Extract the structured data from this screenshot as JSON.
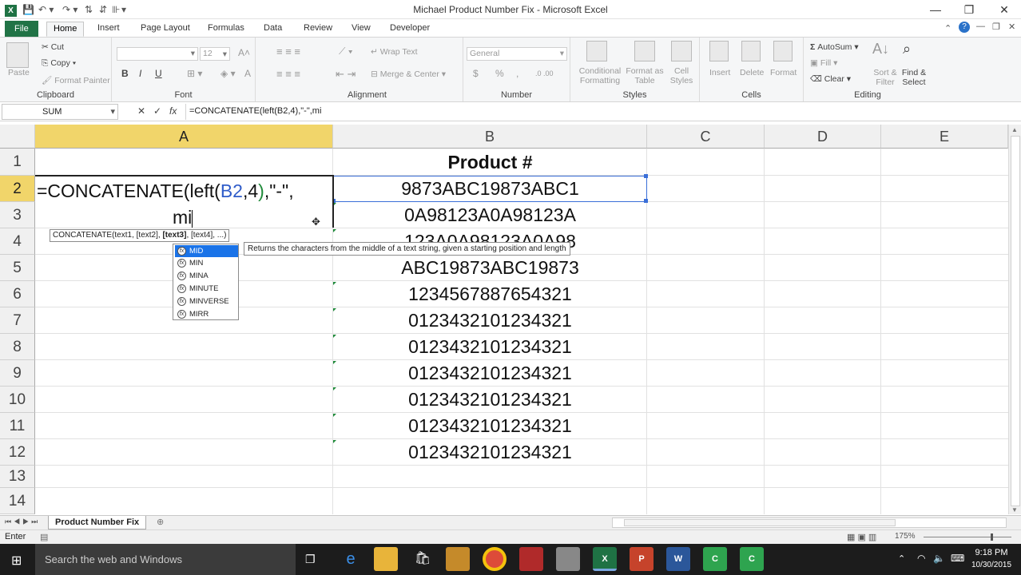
{
  "window": {
    "title": "Michael Product Number Fix - Microsoft Excel"
  },
  "tabs": [
    {
      "label": "File"
    },
    {
      "label": "Home"
    },
    {
      "label": "Insert"
    },
    {
      "label": "Page Layout"
    },
    {
      "label": "Formulas"
    },
    {
      "label": "Data"
    },
    {
      "label": "Review"
    },
    {
      "label": "View"
    },
    {
      "label": "Developer"
    }
  ],
  "ribbon": {
    "clipboard": {
      "name": "Clipboard",
      "paste": "Paste",
      "cut": "Cut",
      "copy": "Copy",
      "format_painter": "Format Painter"
    },
    "font": {
      "name": "Font",
      "size": "12",
      "bold": "B",
      "italic": "I",
      "underline": "U"
    },
    "alignment": {
      "name": "Alignment",
      "wrap": "Wrap Text",
      "merge": "Merge & Center"
    },
    "number": {
      "name": "Number",
      "format": "General",
      "currency": "$",
      "percent": "%",
      "comma": ","
    },
    "styles": {
      "name": "Styles",
      "conditional": "Conditional Formatting",
      "format_table": "Format as Table",
      "cell_styles": "Cell Styles"
    },
    "cells": {
      "name": "Cells",
      "insert": "Insert",
      "delete": "Delete",
      "format": "Format"
    },
    "editing": {
      "name": "Editing",
      "autosum": "AutoSum",
      "fill": "Fill",
      "clear": "Clear",
      "sort": "Sort & Filter",
      "find": "Find & Select"
    }
  },
  "formula_bar": {
    "name_box": "SUM",
    "cancel": "✕",
    "enter": "✓",
    "fx": "fx",
    "formula": "=CONCATENATE(left(B2,4),\"-\",mi"
  },
  "columns": [
    "A",
    "B",
    "C",
    "D",
    "E"
  ],
  "rows": [
    "1",
    "2",
    "3",
    "4",
    "5",
    "6",
    "7",
    "8",
    "9",
    "10",
    "11",
    "12",
    "13",
    "14"
  ],
  "cells": {
    "B1": "Product #",
    "B_values": [
      "9873ABC19873ABC1",
      "0A98123A0A98123A",
      "123A0A98123A0A98",
      "ABC19873ABC19873",
      "1234567887654321",
      "012343210123432​1",
      "0123432101234321",
      "0123432101234321",
      "0123432101234321",
      "0123432101234321",
      "0123432101234321"
    ],
    "A2_line1_prefix": "=CONCATENATE(left(",
    "A2_ref": "B2",
    "A2_after_ref": ",4",
    "A2_close": ")",
    "A2_tail": ",\"-\",",
    "A2_line2": "mi"
  },
  "autocomplete": {
    "tooltip_prefix": "CONCATENATE(text1, [text2], ",
    "tooltip_bold": "[text3]",
    "tooltip_suffix": ", [text4], ...)",
    "items": [
      "MID",
      "MIN",
      "MINA",
      "MINUTE",
      "MINVERSE",
      "MIRR"
    ],
    "description": "Returns the characters from the middle of a text string, given a starting position and length"
  },
  "sheet_tabs": [
    {
      "label": "Product Number Fix"
    }
  ],
  "status": {
    "mode": "Enter",
    "zoom": "175%"
  },
  "taskbar": {
    "search_placeholder": "Search the web and Windows",
    "time": "9:18 PM",
    "date": "10/30/2015"
  }
}
